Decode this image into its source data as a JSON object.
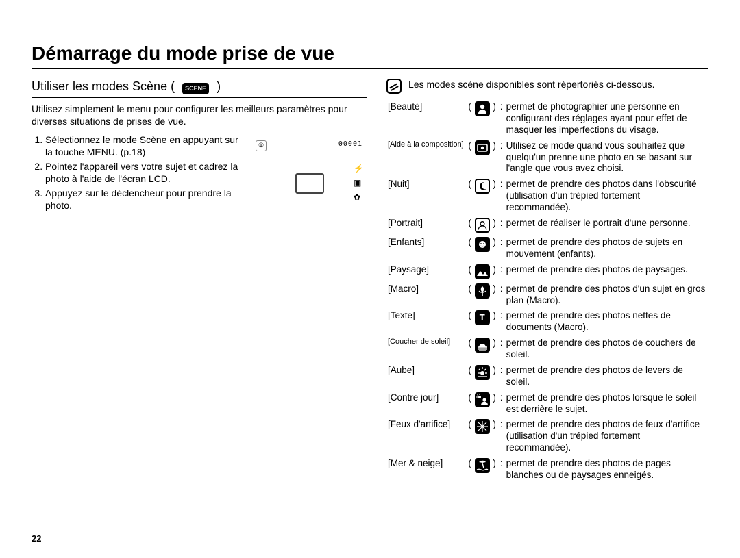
{
  "page_title": "Démarrage du mode prise de vue",
  "page_number": "22",
  "left": {
    "subtitle_prefix": "Utiliser les modes Scène (",
    "subtitle_badge": "SCENE",
    "subtitle_suffix": ")",
    "intro": "Utilisez simplement le menu pour configurer les meilleurs paramètres pour diverses situations de prises de vue.",
    "steps": [
      "Sélectionnez le mode Scène en appuyant sur la touche MENU. (p.18)",
      "Pointez l'appareil vers votre sujet et cadrez la photo à l'aide de l'écran LCD.",
      "Appuyez sur le déclencheur pour prendre la photo."
    ],
    "lcd": {
      "top_left_badge": "①",
      "counter": "00001"
    }
  },
  "right": {
    "note": "Les modes scène disponibles sont répertoriés ci-dessous.",
    "modes": [
      {
        "label": "[Beauté]",
        "label_small": false,
        "icon": "beauty",
        "desc": "permet de photographier une personne en configurant des réglages ayant pour effet de masquer les imperfections du visage."
      },
      {
        "label": "[Aide à la composition]",
        "label_small": true,
        "icon": "guide",
        "desc": "Utilisez ce mode quand vous souhaitez que quelqu'un prenne une photo en se basant sur l'angle que vous avez choisi."
      },
      {
        "label": "[Nuit]",
        "label_small": false,
        "icon": "night",
        "desc": "permet de prendre des photos dans l'obscurité (utilisation d'un trépied fortement recommandée)."
      },
      {
        "label": "[Portrait]",
        "label_small": false,
        "icon": "portrait",
        "desc": "permet de réaliser le portrait d'une personne."
      },
      {
        "label": "[Enfants]",
        "label_small": false,
        "icon": "children",
        "desc": "permet de prendre des photos de sujets en mouvement (enfants)."
      },
      {
        "label": "[Paysage]",
        "label_small": false,
        "icon": "landscape",
        "desc": "permet de prendre des photos de paysages."
      },
      {
        "label": "[Macro]",
        "label_small": false,
        "icon": "macro",
        "desc": "permet de prendre des photos d'un sujet en gros plan (Macro)."
      },
      {
        "label": "[Texte]",
        "label_small": false,
        "icon": "text",
        "desc": "permet de prendre des photos nettes de documents (Macro)."
      },
      {
        "label": "[Coucher de soleil]",
        "label_small": true,
        "icon": "sunset",
        "desc": "permet de prendre des photos de couchers de soleil."
      },
      {
        "label": "[Aube]",
        "label_small": false,
        "icon": "dawn",
        "desc": "permet de prendre des photos de levers de soleil."
      },
      {
        "label": "[Contre jour]",
        "label_small": false,
        "icon": "backlight",
        "desc": "permet de prendre des photos lorsque le soleil est derrière le sujet."
      },
      {
        "label": "[Feux d'artifice]",
        "label_small": false,
        "icon": "firework",
        "desc": "permet de prendre des photos de feux d'artifice (utilisation d'un trépied fortement recommandée)."
      },
      {
        "label": "[Mer & neige]",
        "label_small": false,
        "icon": "beach",
        "desc": "permet de prendre des photos de pages blanches ou de paysages enneigés."
      }
    ]
  }
}
